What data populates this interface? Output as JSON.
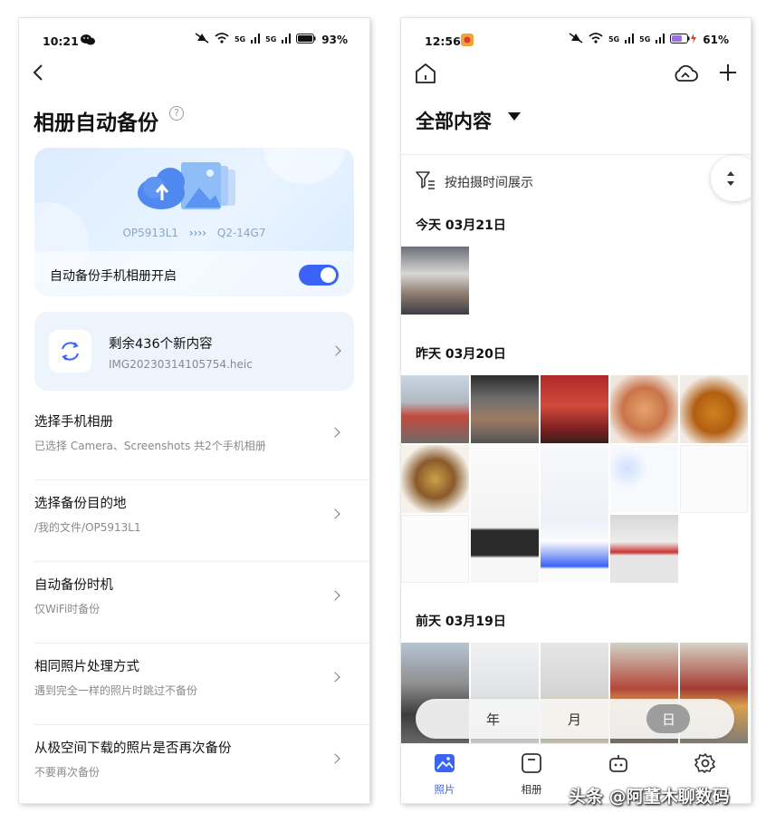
{
  "left": {
    "status": {
      "time": "10:21",
      "battery": "93%",
      "sig1": "5G",
      "sig2": "5G"
    },
    "title": "相册自动备份",
    "help_glyph": "?",
    "hero": {
      "source_device": "OP5913L1",
      "arrows": "›››› ",
      "target_device": "Q2-14G7",
      "switch_label": "自动备份手机相册开启",
      "switch_on": true
    },
    "remaining": {
      "title": "剩余436个新内容",
      "filename": "IMG20230314105754.heic"
    },
    "settings": [
      {
        "title": "选择手机相册",
        "subtitle": "已选择 Camera、Screenshots 共2个手机相册"
      },
      {
        "title": "选择备份目的地",
        "subtitle": "/我的文件/OP5913L1"
      },
      {
        "title": "自动备份时机",
        "subtitle": "仅WiFi时备份"
      },
      {
        "title": "相同照片处理方式",
        "subtitle": "遇到完全一样的照片时跳过不备份"
      },
      {
        "title": "从极空间下载的照片是否再次备份",
        "subtitle": "不要再次备份"
      }
    ]
  },
  "right": {
    "status": {
      "time": "12:56",
      "battery": "61%",
      "sig1": "5G",
      "sig2": "5G"
    },
    "title": "全部内容",
    "filter": "按拍摄时间展示",
    "sections": [
      {
        "label": "今天 03月21日"
      },
      {
        "label": "昨天 03月20日"
      },
      {
        "label": "前天 03月19日"
      }
    ],
    "view_switch": {
      "year": "年",
      "month": "月",
      "day": "日",
      "selected": "日"
    },
    "tabs": [
      {
        "label": "照片",
        "icon": "photo-icon",
        "active": true
      },
      {
        "label": "相册",
        "icon": "album-icon",
        "active": false
      },
      {
        "label": "",
        "icon": "robot-icon",
        "active": false
      },
      {
        "label": "",
        "icon": "settings-icon",
        "active": false
      }
    ],
    "accent": "#3a64f5"
  },
  "watermark": "头条 @阿董木聊数码"
}
